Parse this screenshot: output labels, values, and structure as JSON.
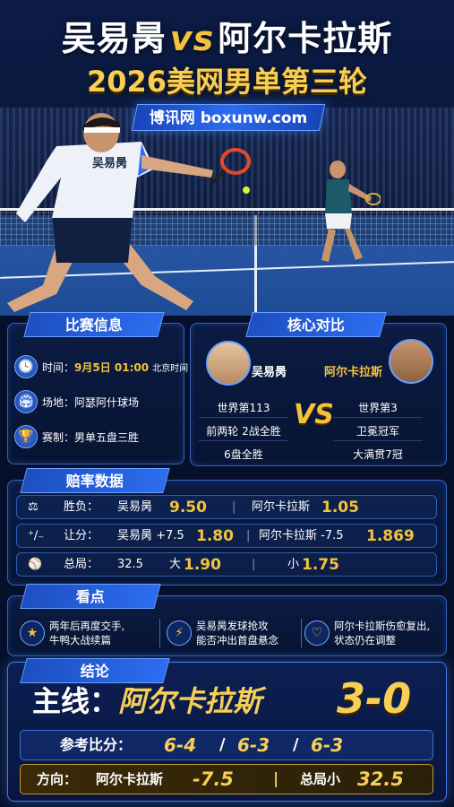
{
  "title": {
    "player_a": "吴易昺",
    "vs": "vs",
    "player_b": "阿尔卡拉斯",
    "subtitle": "2026美网男单第三轮"
  },
  "brand": {
    "label": "博讯网 boxunw.com"
  },
  "shirt_label": "吴易昺",
  "match_info": {
    "header": "比赛信息",
    "time_label": "时间：",
    "time_value": "9月5日 01:00",
    "time_zone": "北京时间",
    "venue": "场地：阿瑟阿什球场",
    "format": "赛制：男单五盘三胜"
  },
  "matchup": {
    "header": "核心对比",
    "left": {
      "name": "吴易昺",
      "stats": [
        "世界第113",
        "前两轮 2战全胜",
        "6盘全胜"
      ]
    },
    "vs": "VS",
    "right": {
      "name": "阿尔卡拉斯",
      "stats": [
        "世界第3",
        "卫冕冠军",
        "大满贯7冠"
      ]
    }
  },
  "odds": {
    "header": "赔率数据",
    "win": {
      "label": "胜负：",
      "a_name": "吴易昺",
      "a_odds": "9.50",
      "sep": "|",
      "b_name": "阿尔卡拉斯",
      "b_odds": "1.05"
    },
    "handicap": {
      "label": "让分：",
      "a_name": "吴易昺 +7.5",
      "a_odds": "1.80",
      "sep": "|",
      "b_name": "阿尔卡拉斯 -7.5",
      "b_odds": "1.869"
    },
    "total": {
      "label": "总局：",
      "line": "32.5",
      "over_label": "大",
      "over_odds": "1.90",
      "sep": "|",
      "under_label": "小",
      "under_odds": "1.75"
    }
  },
  "highlights": {
    "header": "看点",
    "items": [
      {
        "line1": "两年后再度交手,",
        "line2": "牛鸭大战续篇",
        "icon": "star-icon"
      },
      {
        "line1": "吴易昺发球抢攻",
        "line2": "能否冲出首盘悬念",
        "icon": "lightning-icon"
      },
      {
        "line1": "阿尔卡拉斯伤愈复出,",
        "line2": "状态仍在调整",
        "icon": "heart-icon"
      }
    ]
  },
  "conclusion": {
    "header": "结论",
    "main_label": "主线：",
    "main_pick": "阿尔卡拉斯",
    "main_score": "3-0",
    "ref_label": "参考比分：",
    "ref_sets": [
      "6-4",
      "6-3",
      "6-3"
    ],
    "ref_sep": "/",
    "dir_label": "方向：",
    "dir_pick": "阿尔卡拉斯",
    "dir_line": "-7.5",
    "dir_sep": "|",
    "dir_total_label": "总局小",
    "dir_total": "32.5"
  },
  "colors": {
    "gold": "#f4c23c",
    "panel_border": "#3563b8",
    "accent_blue": "#2c6df0"
  }
}
